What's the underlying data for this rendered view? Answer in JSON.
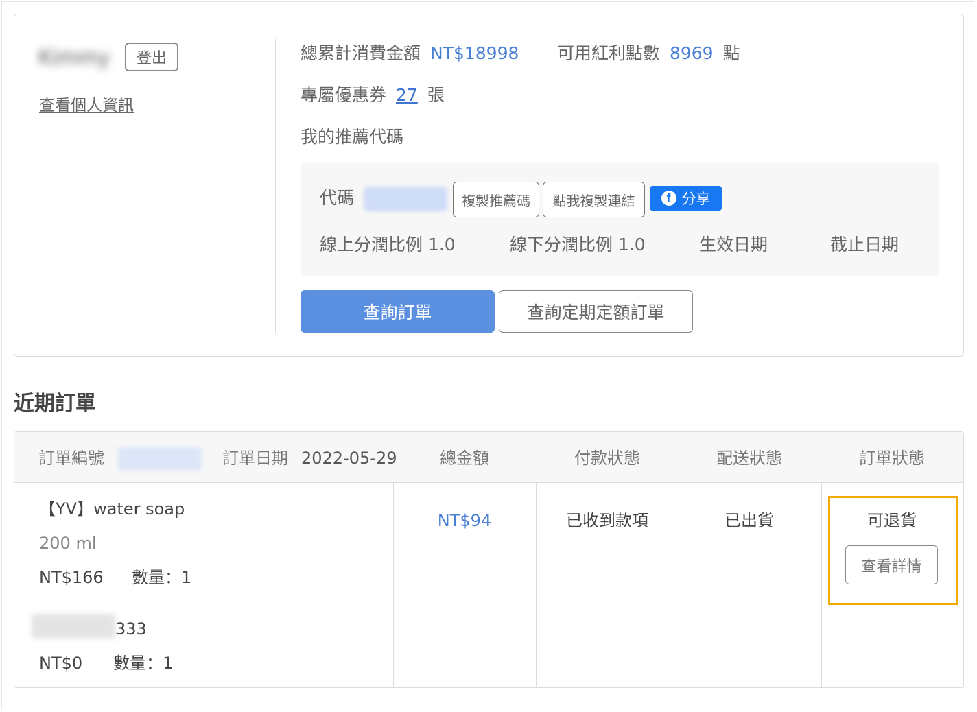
{
  "user": {
    "name": "Kimmy",
    "logout_label": "登出",
    "profile_link": "查看個人資訊"
  },
  "stats": {
    "total_spent_label": "總累計消費金額",
    "total_spent_value": "NT$18998",
    "points_label": "可用紅利點數",
    "points_value": "8969",
    "points_unit": "點",
    "coupon_label": "專屬優惠券",
    "coupon_count": "27",
    "coupon_unit": "張",
    "referral_title": "我的推薦代碼"
  },
  "referral": {
    "code_label": "代碼",
    "copy_code_label": "複製推薦碼",
    "copy_link_label": "點我複製連結",
    "share_label": "分享",
    "online_ratio_label": "線上分潤比例 1.0",
    "offline_ratio_label": "線下分潤比例 1.0",
    "start_date_label": "生效日期",
    "end_date_label": "截止日期"
  },
  "actions": {
    "query_orders": "查詢訂單",
    "query_recurring_orders": "查詢定期定額訂單"
  },
  "recent_orders": {
    "title": "近期訂單",
    "header": {
      "order_no_label": "訂單編號",
      "order_date_label": "訂單日期",
      "order_date_value": "2022-05-29",
      "total_label": "總金額",
      "payment_status_label": "付款狀態",
      "shipping_status_label": "配送狀態",
      "order_status_label": "訂單狀態"
    },
    "items": [
      {
        "name": "【YV】water soap",
        "spec": "200 ml",
        "price": "NT$166",
        "qty": "數量：1"
      },
      {
        "name_suffix": "333",
        "price": "NT$0",
        "qty": "數量：1"
      }
    ],
    "total": "NT$94",
    "payment_status": "已收到款項",
    "shipping_status": "已出貨",
    "order_status": "可退貨",
    "details_label": "查看詳情"
  }
}
